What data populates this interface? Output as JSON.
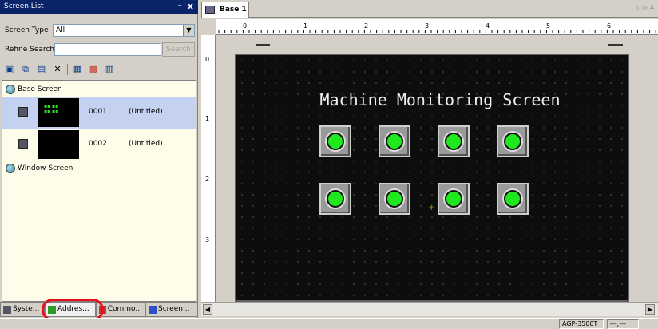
{
  "screen_list": {
    "title": "Screen List",
    "pin_label": "⍅",
    "close_label": "x",
    "screen_type_label": "Screen Type",
    "screen_type_value": "All",
    "refine_search_label": "Refine Search",
    "refine_search_value": "",
    "search_button": "Search",
    "groups": {
      "base": "Base Screen",
      "window": "Window Screen"
    },
    "items": [
      {
        "number": "0001",
        "title": "(Untitled)"
      },
      {
        "number": "0002",
        "title": "(Untitled)"
      }
    ],
    "tabs": [
      {
        "label": "Syste..."
      },
      {
        "label": "Addres..."
      },
      {
        "label": "Commo..."
      },
      {
        "label": "Screen..."
      }
    ]
  },
  "editor": {
    "doc_tab": "Base 1",
    "ruler_labels": [
      "0",
      "1",
      "2",
      "3",
      "4",
      "5",
      "6"
    ],
    "ruler_left_labels": [
      "0",
      "1",
      "2",
      "3"
    ],
    "screen_title": "Machine Monitoring Screen",
    "lamp_count": 8
  },
  "status_bar": {
    "model": "AGP-3500T",
    "coords": "---,---"
  },
  "colors": {
    "title_bar": "#0a246a",
    "lamp_on": "#1fe81f",
    "highlight_oval": "#e8101c"
  }
}
